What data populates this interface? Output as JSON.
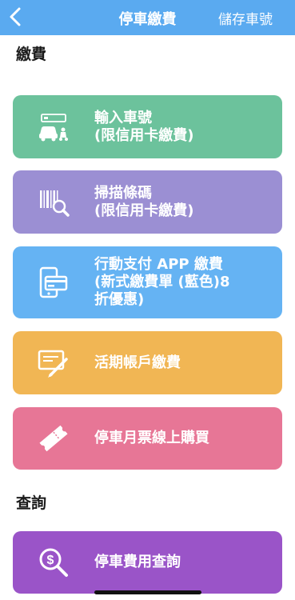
{
  "navbar": {
    "title": "停車繳費",
    "action_label": "儲存車號",
    "back_icon": "chevron-left-icon",
    "background": "#5aaaf0"
  },
  "sections": {
    "pay_title": "繳費",
    "query_title": "查詢"
  },
  "cards": [
    {
      "label": "輸入車號\n(限信用卡繳費)",
      "icon": "car-plate-icon",
      "color": "#6cc29c"
    },
    {
      "label": "掃描條碼\n(限信用卡繳費)",
      "icon": "barcode-scan-icon",
      "color": "#9b8fd3"
    },
    {
      "label": "行動支付 APP 繳費\n(新式繳費單 (藍色)8\n折優惠)",
      "icon": "mobile-pay-icon",
      "color": "#65b3f3"
    },
    {
      "label": "活期帳戶繳費",
      "icon": "account-sign-icon",
      "color": "#f1b654"
    },
    {
      "label": "停車月票線上購買",
      "icon": "ticket-icon",
      "color": "#e77696"
    },
    {
      "label": "停車費用查詢",
      "icon": "fee-search-icon",
      "color": "#9a54c8"
    }
  ]
}
